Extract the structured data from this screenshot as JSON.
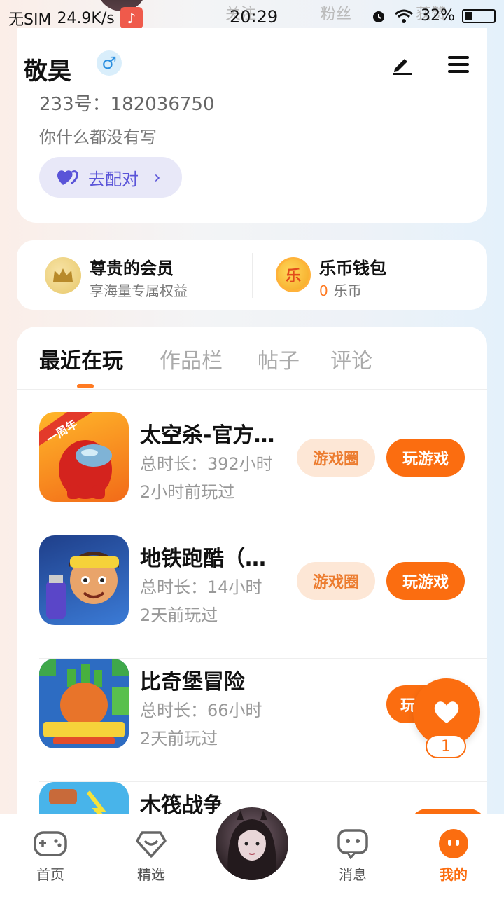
{
  "status_bar": {
    "carrier": "无SIM",
    "speed": "24.9K/s",
    "time": "20:29",
    "battery": "32%",
    "faded_follow": "关注",
    "faded_fans": "粉丝",
    "faded_likes": "获赞"
  },
  "profile": {
    "name": "敬昊",
    "gender_symbol": "♂",
    "account_id": "233号：182036750",
    "bio": "你什么都没有写",
    "match_label": "去配对"
  },
  "benefits": {
    "vip_title": "尊贵的会员",
    "vip_sub": "享海量专属权益",
    "wallet_title": "乐币钱包",
    "wallet_amount": "0",
    "wallet_unit": "乐币",
    "coin_char": "乐"
  },
  "tabs": [
    "最近在玩",
    "作品栏",
    "帖子",
    "评论"
  ],
  "games": [
    {
      "title": "太空杀-官方…",
      "duration": "总时长：392小时",
      "last_played": "2小时前玩过",
      "circle_label": "游戏圈",
      "play_label": "玩游戏"
    },
    {
      "title": "地铁跑酷（…",
      "duration": "总时长：14小时",
      "last_played": "2天前玩过",
      "circle_label": "游戏圈",
      "play_label": "玩游戏"
    },
    {
      "title": "比奇堡冒险",
      "duration": "总时长：66小时",
      "last_played": "2天前玩过",
      "circle_label": "玩",
      "play_label": ""
    },
    {
      "title": "木筏战争",
      "duration": "",
      "last_played": "",
      "circle_label": "",
      "play_label": ""
    }
  ],
  "game1_badge": "一周年",
  "float_like_count": "1",
  "nav": {
    "home": "首页",
    "featured": "精选",
    "messages": "消息",
    "mine": "我的"
  },
  "colors": {
    "accent": "#fb6d10",
    "match_purple": "#5a54d8",
    "circle_bg": "#fde7d6"
  }
}
